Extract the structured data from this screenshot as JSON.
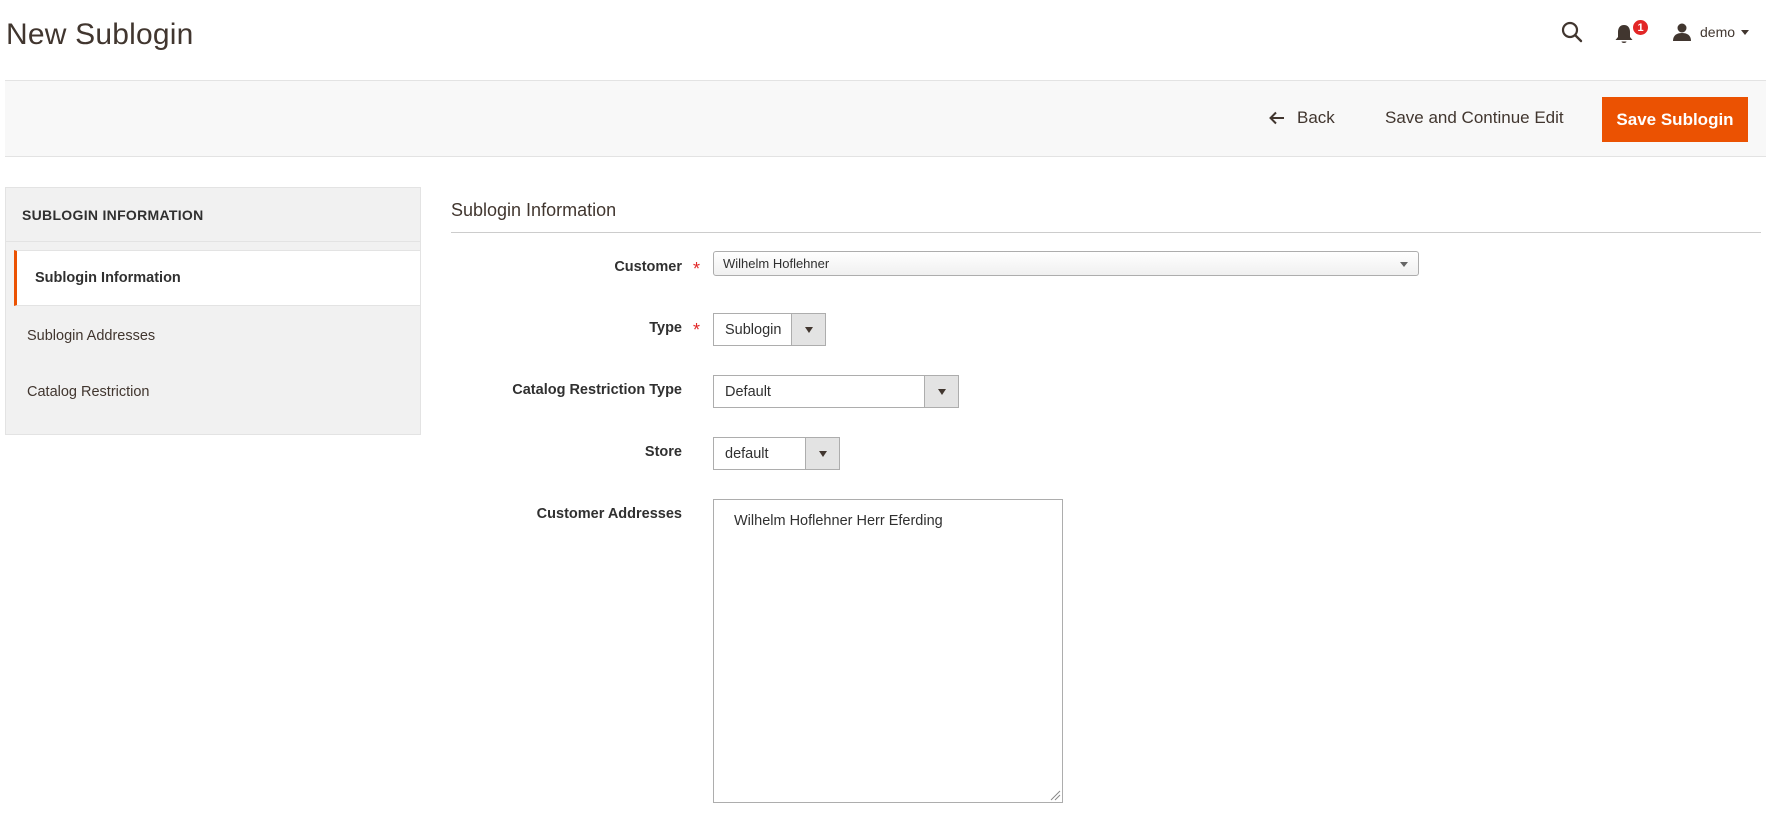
{
  "header": {
    "title": "New Sublogin",
    "notification_count": "1",
    "user_name": "demo"
  },
  "toolbar": {
    "back_label": "Back",
    "save_continue_label": "Save and Continue Edit",
    "save_label": "Save Sublogin"
  },
  "sidebar": {
    "title": "SUBLOGIN INFORMATION",
    "items": [
      {
        "label": "Sublogin Information",
        "active": true
      },
      {
        "label": "Sublogin Addresses",
        "active": false
      },
      {
        "label": "Catalog Restriction",
        "active": false
      }
    ]
  },
  "form": {
    "section_title": "Sublogin Information",
    "customer": {
      "label": "Customer",
      "required": "*",
      "value": "Wilhelm Hoflehner"
    },
    "type": {
      "label": "Type",
      "required": "*",
      "value": "Sublogin"
    },
    "catalog_restriction_type": {
      "label": "Catalog Restriction Type",
      "value": "Default"
    },
    "store": {
      "label": "Store",
      "value": "default"
    },
    "customer_addresses": {
      "label": "Customer Addresses",
      "options": [
        "Wilhelm Hoflehner Herr Eferding"
      ]
    }
  },
  "colors": {
    "accent": "#eb5202",
    "badge": "#e22626",
    "required": "#e22626"
  }
}
